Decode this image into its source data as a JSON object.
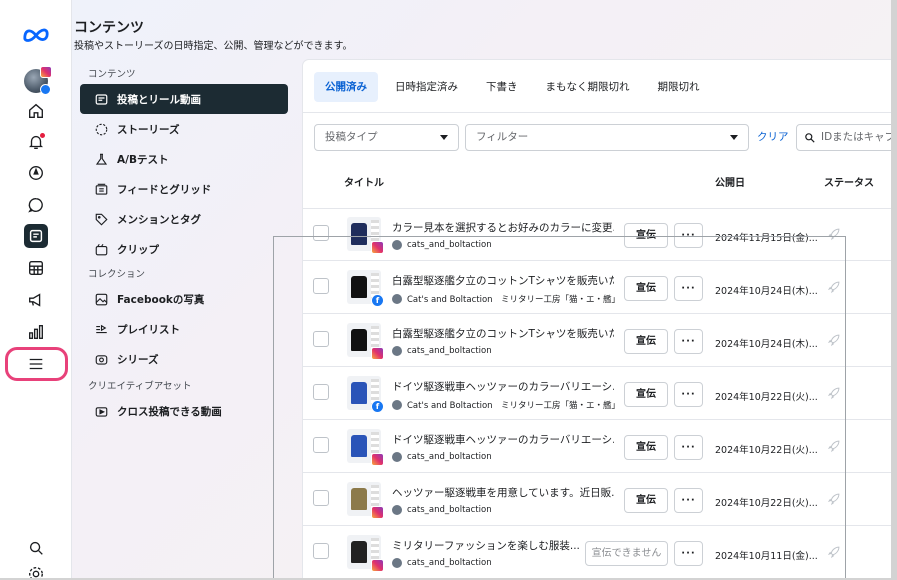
{
  "header": {
    "title": "コンテンツ",
    "subtitle": "投稿やストーリーズの日時指定、公開、管理などができます。"
  },
  "rail": {
    "icons": [
      "meta-logo",
      "avatar",
      "home-icon",
      "notifications-icon",
      "compass-icon",
      "messages-icon",
      "content-icon",
      "planner-icon",
      "ads-icon",
      "insights-icon",
      "menu-icon",
      "search-icon",
      "settings-icon"
    ]
  },
  "nav": {
    "section1": "コンテンツ",
    "items1": [
      {
        "label": "投稿とリール動画",
        "icon": "posts-icon"
      },
      {
        "label": "ストーリーズ",
        "icon": "stories-icon"
      },
      {
        "label": "A/Bテスト",
        "icon": "ab-test-icon"
      },
      {
        "label": "フィードとグリッド",
        "icon": "feed-grid-icon"
      },
      {
        "label": "メンションとタグ",
        "icon": "tag-icon"
      },
      {
        "label": "クリップ",
        "icon": "clip-icon"
      }
    ],
    "section2": "コレクション",
    "items2": [
      {
        "label": "Facebookの写真",
        "icon": "photo-icon"
      },
      {
        "label": "プレイリスト",
        "icon": "playlist-icon"
      },
      {
        "label": "シリーズ",
        "icon": "series-icon"
      }
    ],
    "section3": "クリエイティブアセット",
    "items3": [
      {
        "label": "クロス投稿できる動画",
        "icon": "video-icon"
      }
    ]
  },
  "tabs": [
    "公開済み",
    "日時指定済み",
    "下書き",
    "まもなく期限切れ",
    "期限切れ"
  ],
  "filters": {
    "post_type": "投稿タイプ",
    "filter": "フィルター",
    "clear": "クリア",
    "search_placeholder": "IDまたはキャプ"
  },
  "table": {
    "col_title": "タイトル",
    "col_date": "公開日",
    "col_status": "ステータス",
    "rows": [
      {
        "title": "カラー見本を選択するとお好みのカラーに変更...",
        "account": "cats_and_boltaction",
        "platform": "instagram",
        "button": "宣伝",
        "date": "2024年11月15日(金)...",
        "shirt_color": "#1f2d5c"
      },
      {
        "title": "白露型駆逐艦夕立のコットンTシャツを販売いた...",
        "account": "Cat's and Boltaction　ミリタリー工房「猫・エ・艦」",
        "platform": "facebook",
        "button": "宣伝",
        "date": "2024年10月24日(木)...",
        "shirt_color": "#111111"
      },
      {
        "title": "白露型駆逐艦夕立のコットンTシャツを販売いた...",
        "account": "cats_and_boltaction",
        "platform": "instagram",
        "button": "宣伝",
        "date": "2024年10月24日(木)...",
        "shirt_color": "#111111"
      },
      {
        "title": "ドイツ駆逐戦車ヘッツァーのカラーバリエーシ...",
        "account": "Cat's and Boltaction　ミリタリー工房「猫・エ・艦」",
        "platform": "facebook",
        "button": "宣伝",
        "date": "2024年10月22日(火)...",
        "shirt_color": "#2a54b8"
      },
      {
        "title": "ドイツ駆逐戦車ヘッツァーのカラーバリエーシ...",
        "account": "cats_and_boltaction",
        "platform": "instagram",
        "button": "宣伝",
        "date": "2024年10月22日(火)...",
        "shirt_color": "#2a54b8"
      },
      {
        "title": "ヘッツァー駆逐戦車を用意しています。近日販...",
        "account": "cats_and_boltaction",
        "platform": "instagram",
        "button": "宣伝",
        "date": "2024年10月22日(火)...",
        "shirt_color": "#8c7a4a"
      },
      {
        "title": "ミリタリーファッションを楽しむ服装...",
        "account": "cats_and_boltaction",
        "platform": "instagram",
        "button": "宣伝できません",
        "button_disabled": true,
        "date": "2024年10月11日(金)...",
        "shirt_color": "#222222"
      }
    ]
  },
  "colors": {
    "accent": "#0a62d3",
    "nav_active": "#1c2b33",
    "highlight": "#e8417a"
  }
}
